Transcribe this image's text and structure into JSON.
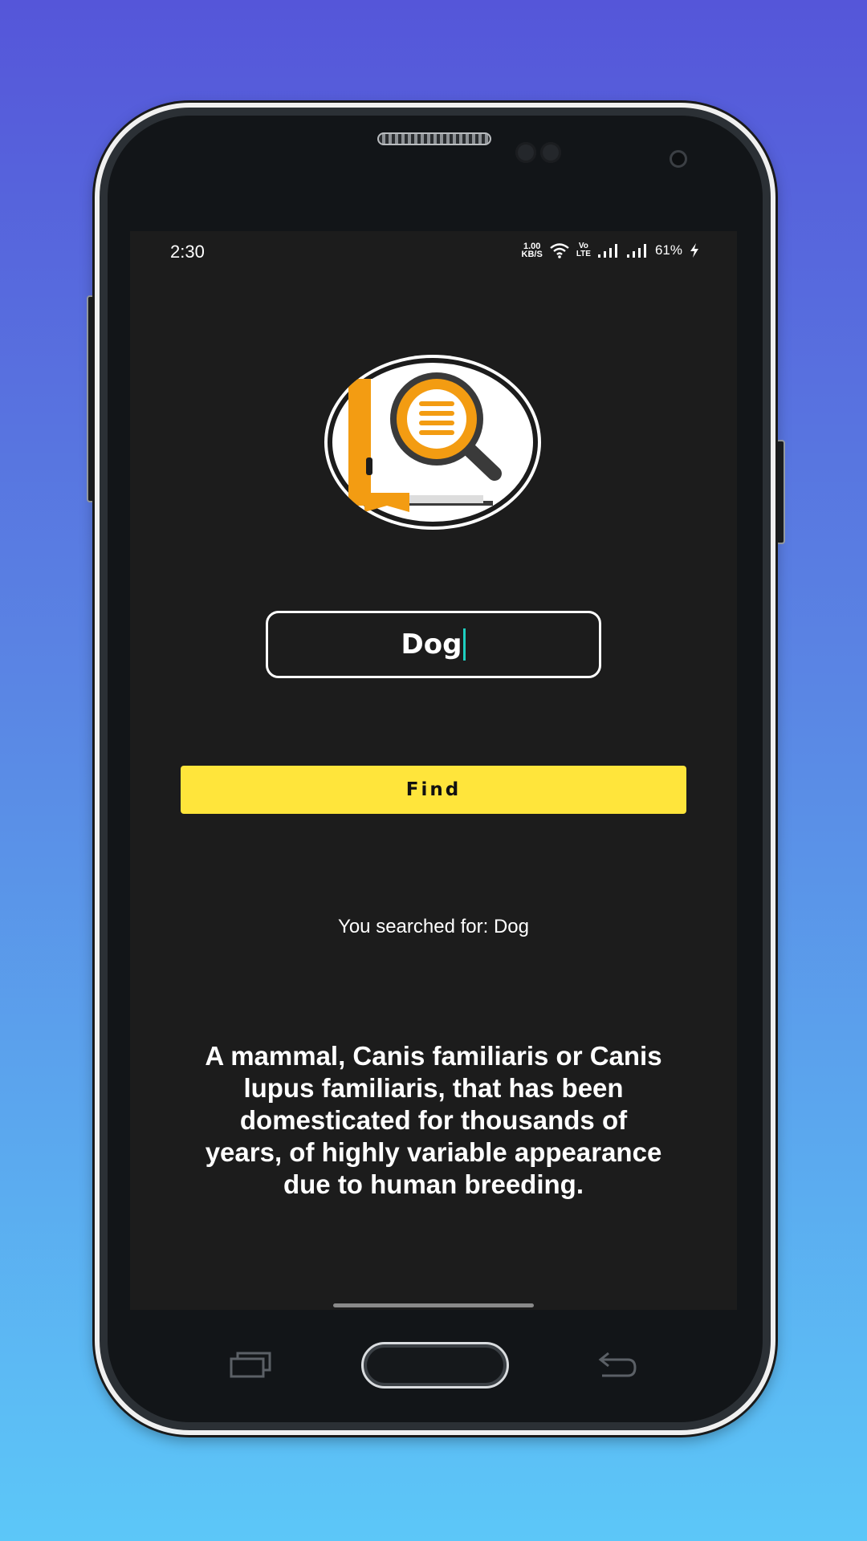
{
  "status_bar": {
    "time": "2:30",
    "net_speed_value": "1.00",
    "net_speed_unit": "KB/S",
    "volte_top": "Vo",
    "volte_bottom": "LTE",
    "battery": "61%"
  },
  "app": {
    "logo_icon": "dictionary-book-search-icon",
    "search": {
      "value": "Dog"
    },
    "find_label": "Find",
    "searched_for": "You searched for: Dog",
    "definition": "A mammal, Canis familiaris or Canis lupus familiaris, that has been domesticated for thousands of years, of highly variable appearance due to human breeding."
  },
  "colors": {
    "background_top": "#5556d9",
    "background_bottom": "#5cc7f8",
    "screen": "#1c1c1c",
    "find_button": "#ffe53b",
    "logo_orange": "#f39c12",
    "caret": "#1ecfc0"
  }
}
